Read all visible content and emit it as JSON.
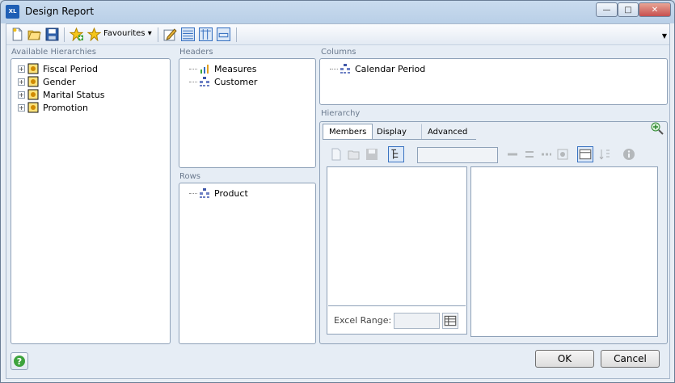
{
  "window": {
    "title": "Design Report",
    "app_icon_text": "XL"
  },
  "toolbar": {
    "favourites_label": "Favourites",
    "icons": [
      "new-report-icon",
      "open-report-icon",
      "save-icon",
      "add-favourite-icon",
      "favourites-star-icon",
      "edit-icon",
      "layout-headers-icon",
      "layout-columns-icon",
      "layout-rows-icon"
    ]
  },
  "available": {
    "label": "Available Hierarchies",
    "items": [
      {
        "label": "Fiscal Period"
      },
      {
        "label": "Gender"
      },
      {
        "label": "Marital Status"
      },
      {
        "label": "Promotion"
      }
    ]
  },
  "headers": {
    "label": "Headers",
    "items": [
      {
        "label": "Measures",
        "icon": "measures-icon"
      },
      {
        "label": "Customer",
        "icon": "hierarchy-icon"
      }
    ]
  },
  "rows": {
    "label": "Rows",
    "items": [
      {
        "label": "Product"
      }
    ]
  },
  "columns": {
    "label": "Columns",
    "items": [
      {
        "label": "Calendar Period"
      }
    ]
  },
  "hierarchy": {
    "label": "Hierarchy",
    "tabs": [
      {
        "label": "Members",
        "active": true
      },
      {
        "label": "Display",
        "active": false
      },
      {
        "label": "Advanced",
        "active": false
      }
    ],
    "excel_range_label": "Excel Range:",
    "excel_range_value": ""
  },
  "buttons": {
    "ok": "OK",
    "cancel": "Cancel"
  }
}
